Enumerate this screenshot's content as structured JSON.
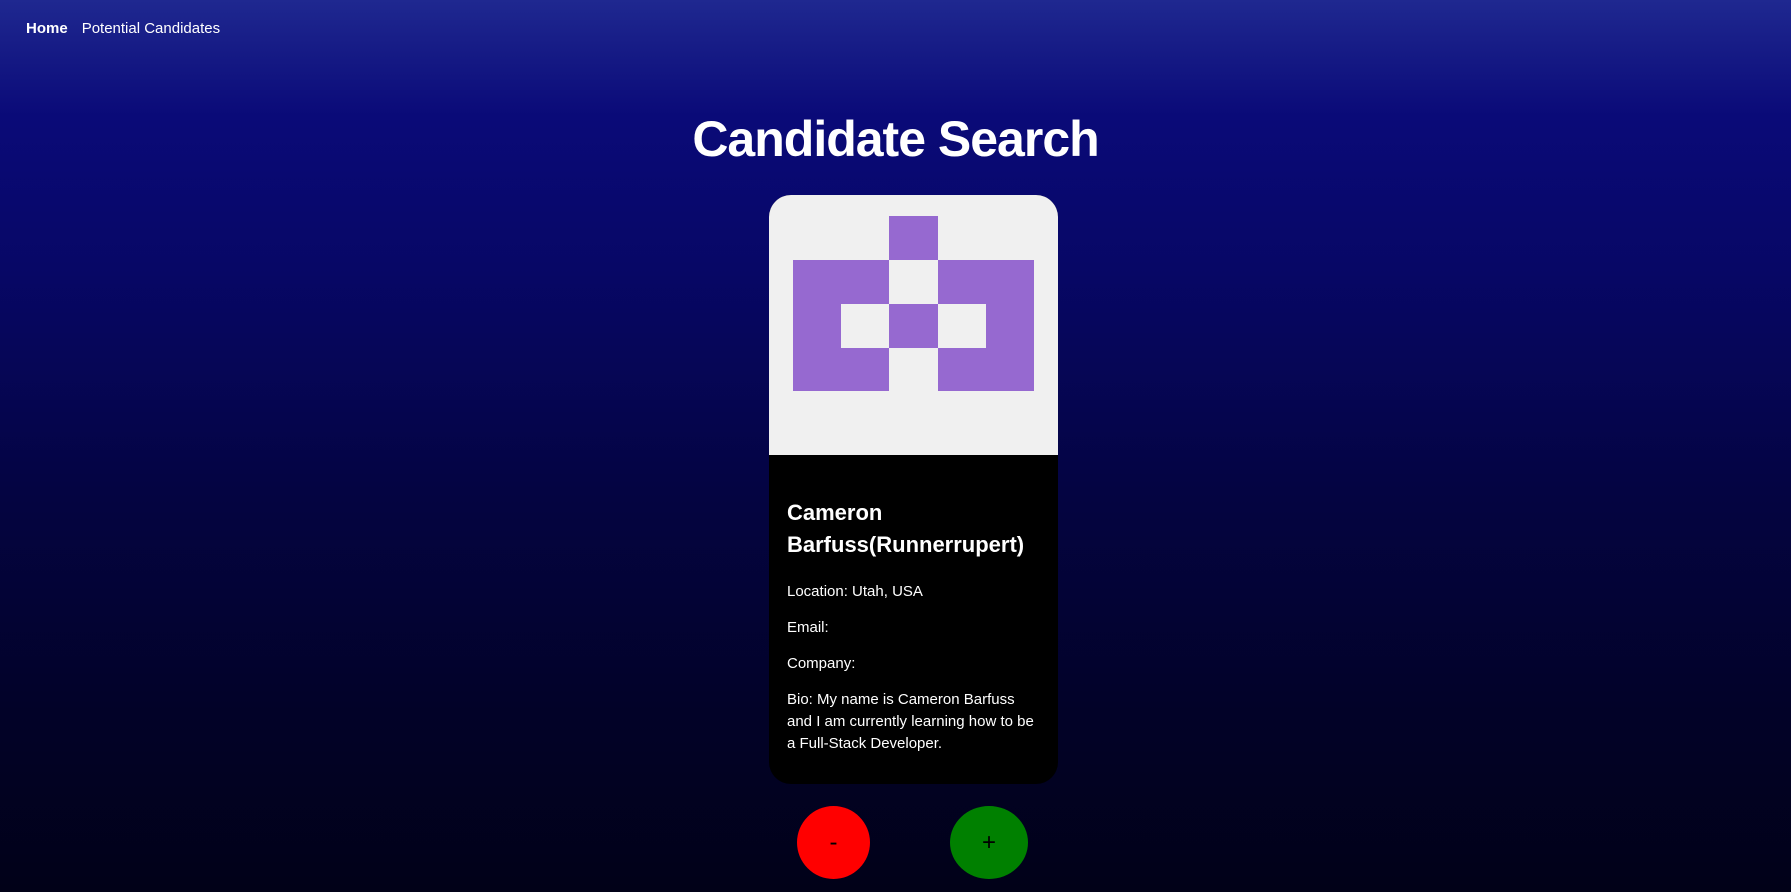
{
  "nav": {
    "home": "Home",
    "potential_candidates": "Potential Candidates"
  },
  "page": {
    "title": "Candidate Search"
  },
  "candidate": {
    "name": "Cameron Barfuss(Runnerrupert)",
    "location": "Location: Utah, USA",
    "email": "Email:",
    "company": "Company:",
    "bio": "Bio: My name is Cameron Barfuss and I am currently learning how to be a Full-Stack Developer.",
    "avatar_color": "#9669d0",
    "avatar_bg": "#f0f0f0"
  },
  "actions": {
    "reject": "-",
    "accept": "+"
  },
  "colors": {
    "reject": "#ff0000",
    "accept": "#008000"
  }
}
